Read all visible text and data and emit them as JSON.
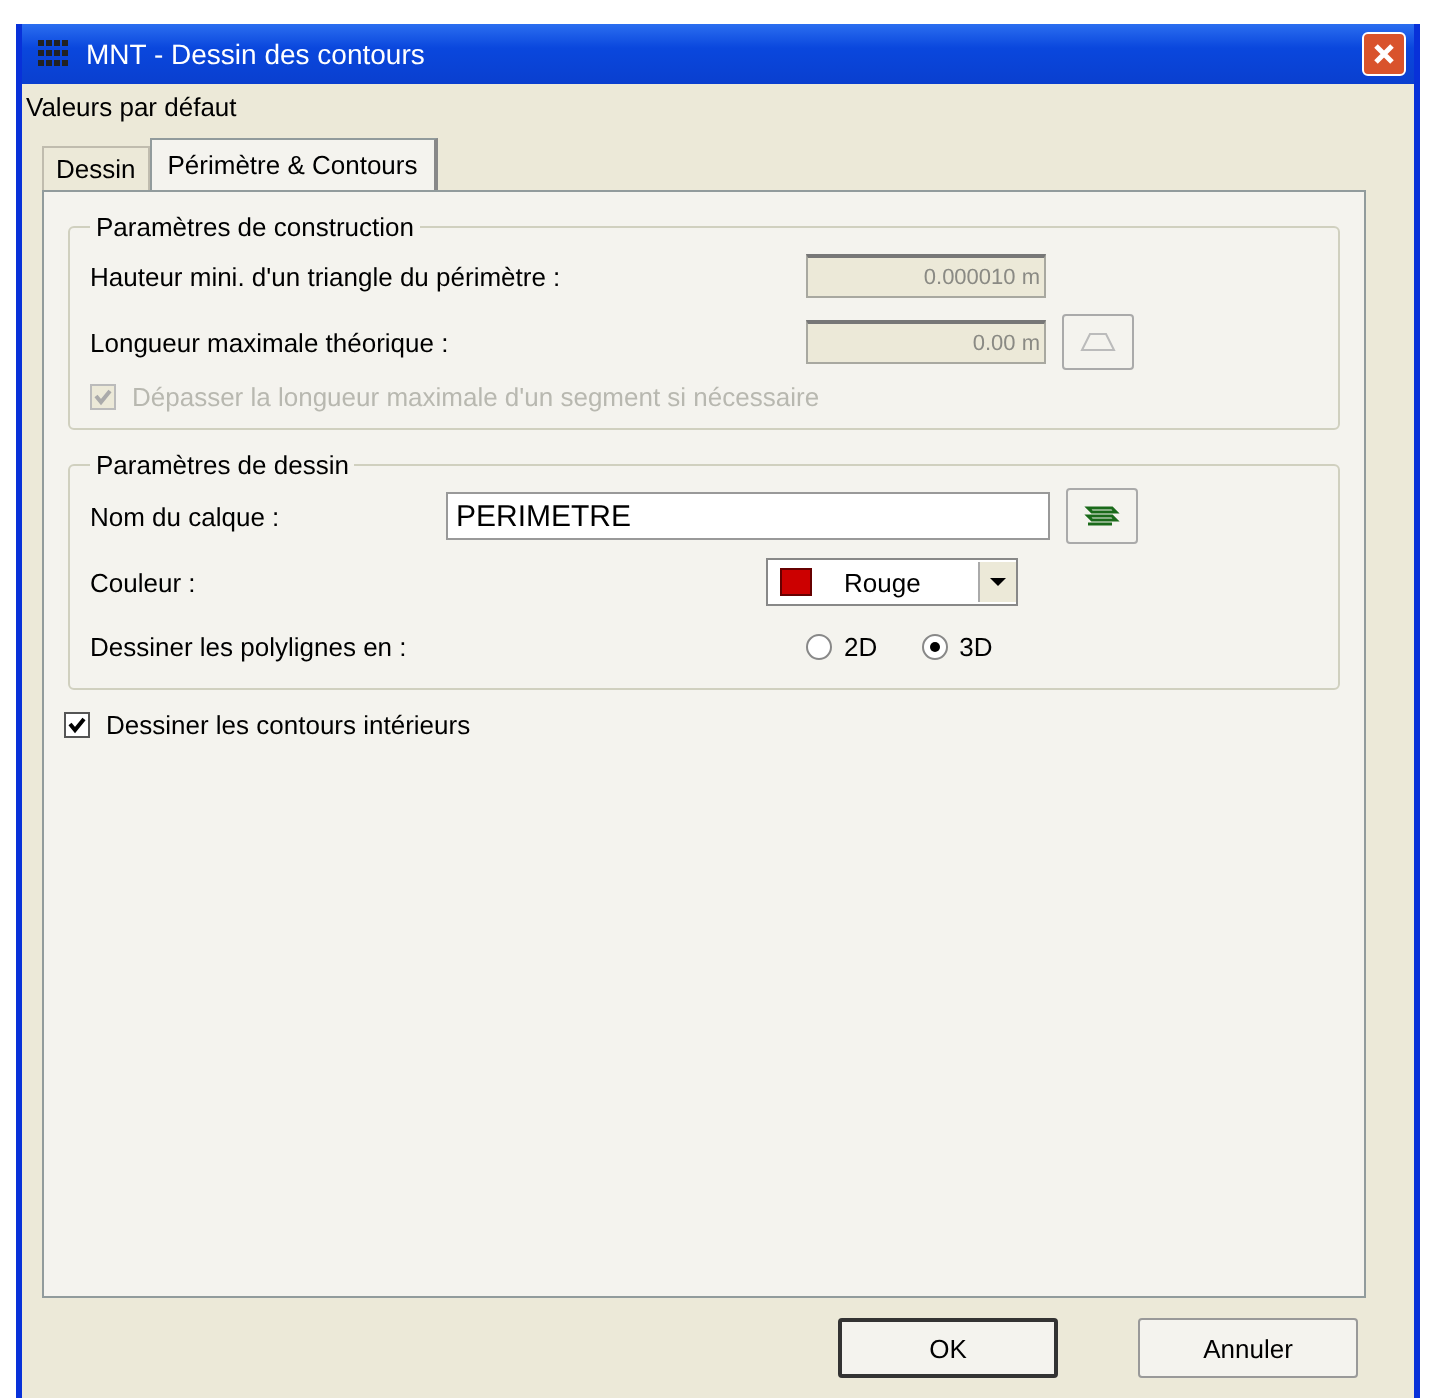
{
  "window": {
    "title": "MNT - Dessin des contours"
  },
  "menu": {
    "label": "Valeurs par défaut"
  },
  "tabs": [
    {
      "label": "Dessin",
      "selected": false
    },
    {
      "label": "Périmètre & Contours",
      "selected": true
    }
  ],
  "construction": {
    "title": "Paramètres de construction",
    "fields": [
      {
        "label": "Hauteur mini. d'un triangle du périmètre :",
        "value": "0.000010 m",
        "disabled": true,
        "pick": false
      },
      {
        "label": "Longueur maximale théorique :",
        "value": "0.00 m",
        "disabled": true,
        "pick": true
      }
    ],
    "exceed": {
      "label": "Dépasser la longueur maximale d'un segment si nécessaire",
      "checked": true,
      "disabled": true
    }
  },
  "drawing": {
    "title": "Paramètres de dessin",
    "layer": {
      "label": "Nom du calque :",
      "value": "PERIMETRE"
    },
    "color": {
      "label": "Couleur :",
      "value": "Rouge",
      "color": "#cc0000"
    },
    "polylines": {
      "label": "Dessiner les polylignes en :",
      "options": [
        {
          "label": "2D",
          "selected": false
        },
        {
          "label": "3D",
          "selected": true
        }
      ]
    }
  },
  "inner": {
    "label": "Dessiner les contours intérieurs",
    "checked": true,
    "disabled": false
  },
  "buttons": [
    {
      "label": "OK",
      "kind": "default"
    },
    {
      "label": "Annuler",
      "kind": "normal"
    }
  ]
}
